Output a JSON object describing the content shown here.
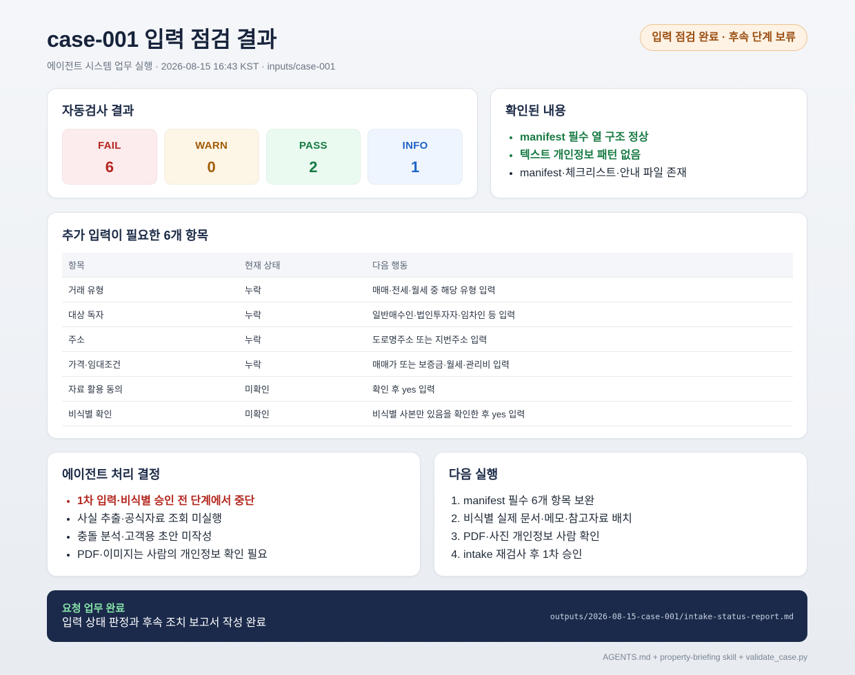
{
  "header": {
    "title": "case-001 입력 점검 결과",
    "subtitle": "에이전트 시스템 업무 실행 · 2026-08-15 16:43 KST · inputs/case-001",
    "status_badge": {
      "text": "입력 점검 완료 · 후속 단계 보류",
      "color": "#9a4e10",
      "background": "#fdf2e4",
      "border": "#f0c48e"
    }
  },
  "auto_check": {
    "title": "자동검사 결과",
    "stats": [
      {
        "label": "FAIL",
        "count": 6,
        "color": "#b3261e",
        "background": "#fdeced"
      },
      {
        "label": "WARN",
        "count": 0,
        "color": "#a15c07",
        "background": "#fdf5e6"
      },
      {
        "label": "PASS",
        "count": 2,
        "color": "#177a43",
        "background": "#eafaf1"
      },
      {
        "label": "INFO",
        "count": 1,
        "color": "#1f63c6",
        "background": "#eef5fe"
      }
    ]
  },
  "confirmed": {
    "title": "확인된 내용",
    "items": [
      {
        "text": "manifest 필수 열 구조 정상",
        "color": "#177a43"
      },
      {
        "text": "텍스트 개인정보 패턴 없음",
        "color": "#177a43"
      },
      {
        "text": "manifest·체크리스트·안내 파일 존재",
        "color": "#1f2937"
      }
    ]
  },
  "missing_inputs": {
    "title": "추가 입력이 필요한 6개 항목",
    "columns": {
      "item": "항목",
      "status": "현재 상태",
      "action": "다음 행동"
    },
    "rows": [
      {
        "item": "거래 유형",
        "status": "누락",
        "action": "매매·전세·월세 중 해당 유형 입력"
      },
      {
        "item": "대상 독자",
        "status": "누락",
        "action": "일반매수인·법인투자자·임차인 등 입력"
      },
      {
        "item": "주소",
        "status": "누락",
        "action": "도로명주소 또는 지번주소 입력"
      },
      {
        "item": "가격·임대조건",
        "status": "누락",
        "action": "매매가 또는 보증금·월세·관리비 입력"
      },
      {
        "item": "자료 활용 동의",
        "status": "미확인",
        "action": "확인 후 yes 입력"
      },
      {
        "item": "비식별 확인",
        "status": "미확인",
        "action": "비식별 사본만 있음을 확인한 후 yes 입력"
      }
    ]
  },
  "agent_decision": {
    "title": "에이전트 처리 결정",
    "items": [
      {
        "text": "1차 입력·비식별 승인 전 단계에서 중단",
        "color": "#b3261e"
      },
      {
        "text": "사실 추출·공식자료 조회 미실행",
        "color": "#1f2937"
      },
      {
        "text": "충돌 분석·고객용 초안 미작성",
        "color": "#1f2937"
      },
      {
        "text": "PDF·이미지는 사람의 개인정보 확인 필요",
        "color": "#1f2937"
      }
    ]
  },
  "next_steps": {
    "title": "다음 실행",
    "items": [
      "manifest 필수 6개 항목 보완",
      "비식별 실제 문서·메모·참고자료 배치",
      "PDF·사진 개인정보 사람 확인",
      "intake 재검사 후 1차 승인"
    ]
  },
  "completion": {
    "label": "요청 업무 완료",
    "message": "입력 상태 판정과 후속 조치 보고서 작성 완료",
    "output_path": "outputs/2026-08-15-case-001/intake-status-report.md",
    "background": "#1b2a4b",
    "label_color": "#86e3a9"
  },
  "footnote": "AGENTS.md + property-briefing skill + validate_case.py"
}
